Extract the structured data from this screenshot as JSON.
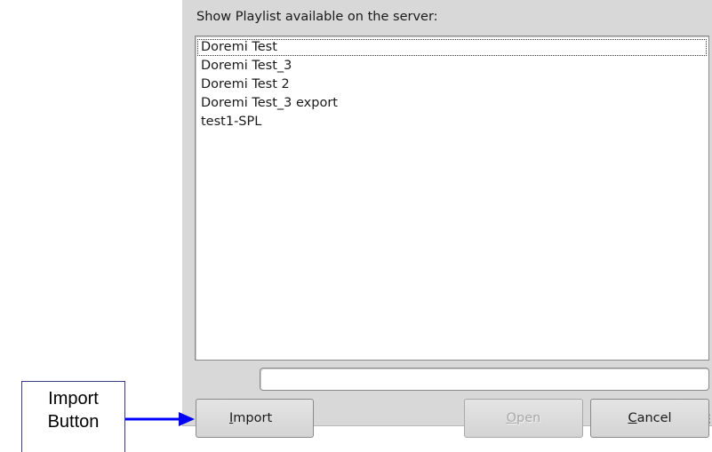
{
  "dialog": {
    "heading": "Show Playlist available on the server:",
    "playlists": [
      "Doremi Test",
      "Doremi Test_3",
      "Doremi Test 2",
      "Doremi Test_3 export",
      "test1-SPL"
    ],
    "text_field": {
      "value": ""
    },
    "buttons": {
      "import": {
        "mnemonic": "I",
        "rest": "mport",
        "enabled": true
      },
      "open": {
        "mnemonic": "O",
        "rest": "pen",
        "enabled": false
      },
      "cancel": {
        "mnemonic": "C",
        "rest": "ancel",
        "enabled": true
      }
    }
  },
  "annotation": {
    "line1": "Import",
    "line2": "Button",
    "arrow_color": "#0000ff",
    "box_border_color": "#3a3a8a"
  }
}
